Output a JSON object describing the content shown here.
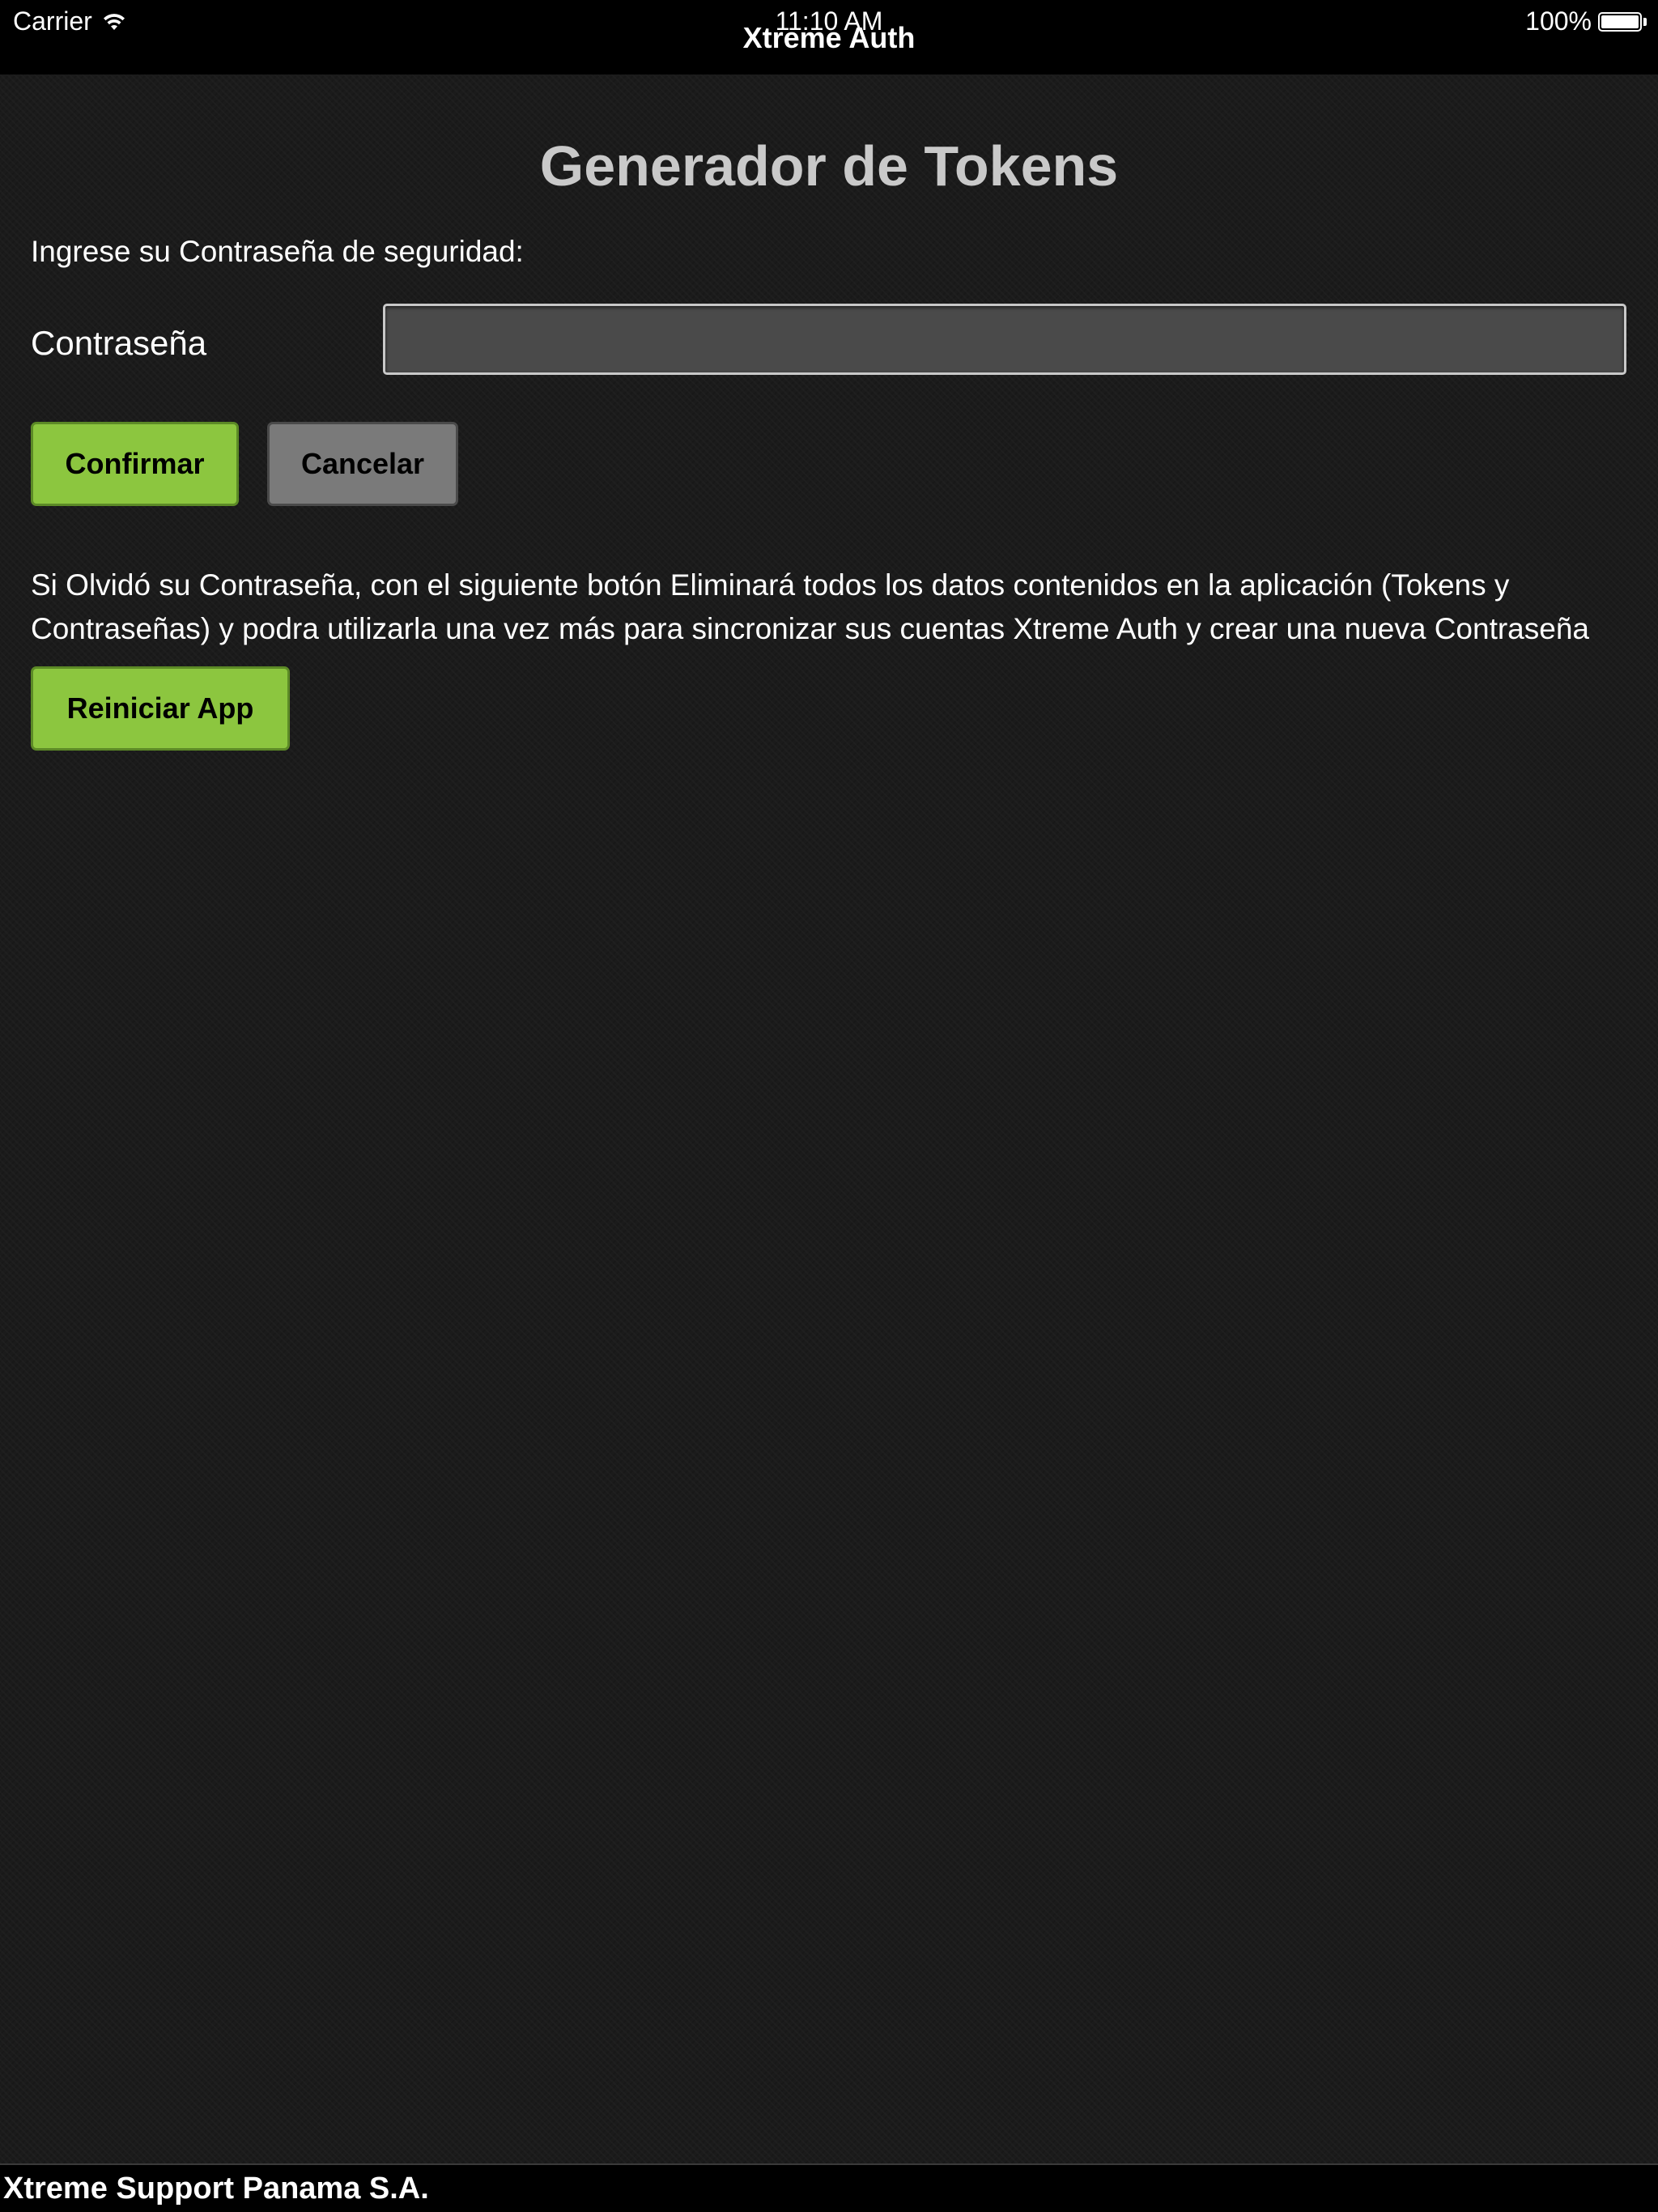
{
  "status_bar": {
    "carrier": "Carrier",
    "time": "11:10 AM",
    "battery": "100%",
    "app_title": "Xtreme Auth",
    "icons": [
      "wifi-icon",
      "battery-icon"
    ]
  },
  "main": {
    "title": "Generador de Tokens",
    "prompt": "Ingrese su Contraseña de seguridad:",
    "password_label": "Contraseña",
    "password_value": "",
    "confirm_label": "Confirmar",
    "cancel_label": "Cancelar",
    "info_text": "Si Olvidó su Contraseña, con el siguiente botón Eliminará todos los datos contenidos en la aplicación (Tokens y Contraseñas) y podra utilizarla una vez más para sincronizar sus cuentas Xtreme Auth y crear una nueva Contraseña",
    "reset_label": "Reiniciar App"
  },
  "footer": {
    "company": "Xtreme Support Panama S.A."
  },
  "colors": {
    "accent_green": "#8cc63f",
    "button_gray": "#7a7a7a",
    "background": "#1b1b1b",
    "title_gray": "#c9c9c9"
  }
}
